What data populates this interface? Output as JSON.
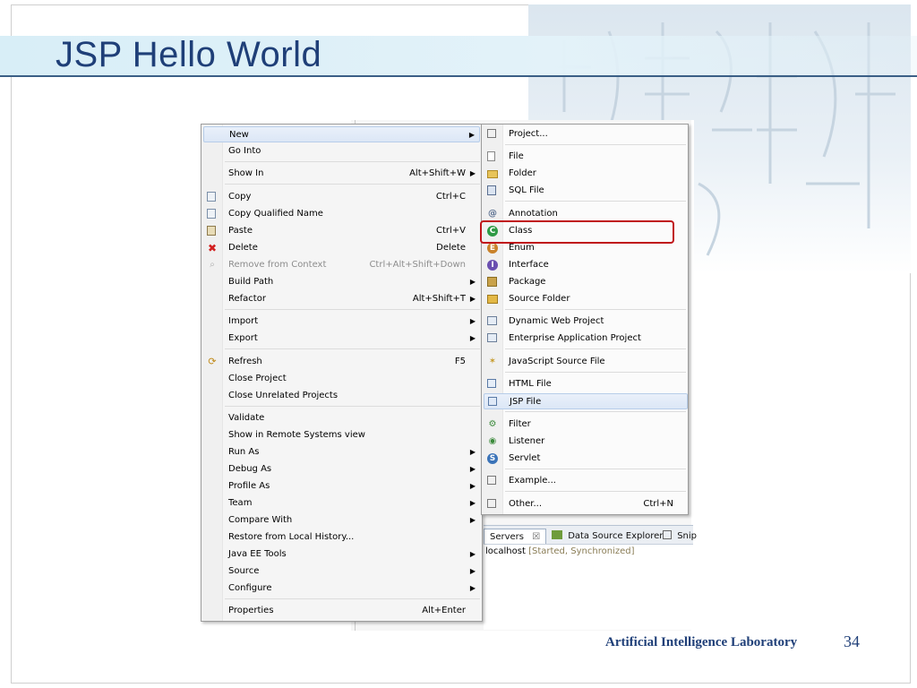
{
  "slide": {
    "title": "JSP Hello World",
    "footer_lab": "Artificial Intelligence Laboratory",
    "page_number": "34"
  },
  "context_menu": {
    "items": [
      {
        "label": "New",
        "accel": "",
        "submenu": true
      },
      {
        "label": "Go Into",
        "accel": "",
        "submenu": false
      },
      {
        "label": "Show In",
        "accel": "Alt+Shift+W",
        "submenu": true
      },
      {
        "label": "Copy",
        "accel": "Ctrl+C",
        "submenu": false
      },
      {
        "label": "Copy Qualified Name",
        "accel": "",
        "submenu": false
      },
      {
        "label": "Paste",
        "accel": "Ctrl+V",
        "submenu": false
      },
      {
        "label": "Delete",
        "accel": "Delete",
        "submenu": false
      },
      {
        "label": "Remove from Context",
        "accel": "Ctrl+Alt+Shift+Down",
        "submenu": false
      },
      {
        "label": "Build Path",
        "accel": "",
        "submenu": true
      },
      {
        "label": "Refactor",
        "accel": "Alt+Shift+T",
        "submenu": true
      },
      {
        "label": "Import",
        "accel": "",
        "submenu": true
      },
      {
        "label": "Export",
        "accel": "",
        "submenu": true
      },
      {
        "label": "Refresh",
        "accel": "F5",
        "submenu": false
      },
      {
        "label": "Close Project",
        "accel": "",
        "submenu": false
      },
      {
        "label": "Close Unrelated Projects",
        "accel": "",
        "submenu": false
      },
      {
        "label": "Validate",
        "accel": "",
        "submenu": false
      },
      {
        "label": "Show in Remote Systems view",
        "accel": "",
        "submenu": false
      },
      {
        "label": "Run As",
        "accel": "",
        "submenu": true
      },
      {
        "label": "Debug As",
        "accel": "",
        "submenu": true
      },
      {
        "label": "Profile As",
        "accel": "",
        "submenu": true
      },
      {
        "label": "Team",
        "accel": "",
        "submenu": true
      },
      {
        "label": "Compare With",
        "accel": "",
        "submenu": true
      },
      {
        "label": "Restore from Local History...",
        "accel": "",
        "submenu": false
      },
      {
        "label": "Java EE Tools",
        "accel": "",
        "submenu": true
      },
      {
        "label": "Source",
        "accel": "",
        "submenu": true
      },
      {
        "label": "Configure",
        "accel": "",
        "submenu": true
      },
      {
        "label": "Properties",
        "accel": "Alt+Enter",
        "submenu": false
      }
    ]
  },
  "new_submenu": {
    "items": [
      {
        "label": "Project...",
        "accel": ""
      },
      {
        "label": "File",
        "accel": ""
      },
      {
        "label": "Folder",
        "accel": ""
      },
      {
        "label": "SQL File",
        "accel": ""
      },
      {
        "label": "Annotation",
        "accel": ""
      },
      {
        "label": "Class",
        "accel": ""
      },
      {
        "label": "Enum",
        "accel": ""
      },
      {
        "label": "Interface",
        "accel": ""
      },
      {
        "label": "Package",
        "accel": ""
      },
      {
        "label": "Source Folder",
        "accel": ""
      },
      {
        "label": "Dynamic Web Project",
        "accel": ""
      },
      {
        "label": "Enterprise Application Project",
        "accel": ""
      },
      {
        "label": "JavaScript Source File",
        "accel": ""
      },
      {
        "label": "HTML File",
        "accel": ""
      },
      {
        "label": "JSP File",
        "accel": ""
      },
      {
        "label": "Filter",
        "accel": ""
      },
      {
        "label": "Listener",
        "accel": ""
      },
      {
        "label": "Servlet",
        "accel": ""
      },
      {
        "label": "Example...",
        "accel": ""
      },
      {
        "label": "Other...",
        "accel": "Ctrl+N"
      }
    ]
  },
  "views": {
    "tab_servers": "Servers",
    "tab_close": "☒",
    "tab_datasource": "Data Source Explorer",
    "tab_snippets": "Snip",
    "server_name": "localhost",
    "server_status": "[Started, Synchronized]"
  },
  "colors": {
    "title": "#1f3f78",
    "highlight": "#c0151a"
  },
  "icons": {
    "copy": "copy-icon",
    "paste": "paste-icon",
    "delete": "delete-icon",
    "refresh": "refresh-icon",
    "class": "class-icon"
  }
}
